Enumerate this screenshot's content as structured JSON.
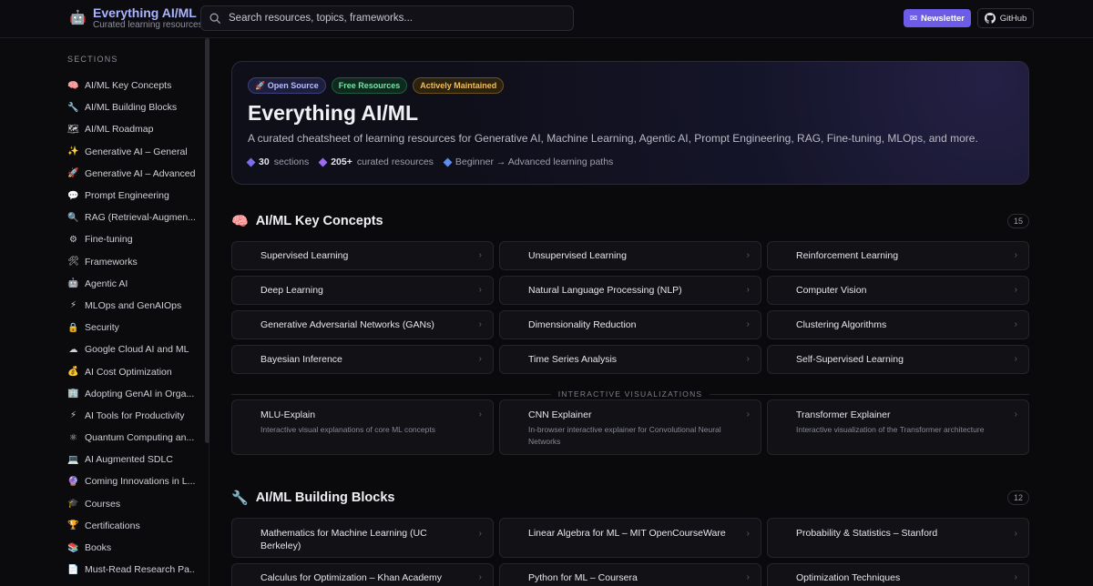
{
  "header": {
    "brand_title": "Everything AI/ML",
    "brand_subtitle": "Curated learning resources",
    "search_placeholder": "Search resources, topics, frameworks...",
    "newsletter_label": "Newsletter",
    "github_label": "GitHub"
  },
  "sidebar": {
    "title": "SECTIONS",
    "items": [
      {
        "icon": "🧠",
        "label": "AI/ML Key Concepts"
      },
      {
        "icon": "🔧",
        "label": "AI/ML Building Blocks"
      },
      {
        "icon": "🗺",
        "label": "AI/ML Roadmap"
      },
      {
        "icon": "✨",
        "label": "Generative AI – General"
      },
      {
        "icon": "🚀",
        "label": "Generative AI – Advanced"
      },
      {
        "icon": "💬",
        "label": "Prompt Engineering"
      },
      {
        "icon": "🔍",
        "label": "RAG (Retrieval-Augmen..."
      },
      {
        "icon": "⚙",
        "label": "Fine-tuning"
      },
      {
        "icon": "🛠",
        "label": "Frameworks"
      },
      {
        "icon": "🤖",
        "label": "Agentic AI"
      },
      {
        "icon": "⚡",
        "label": "MLOps and GenAIOps"
      },
      {
        "icon": "🔒",
        "label": "Security"
      },
      {
        "icon": "☁",
        "label": "Google Cloud AI and ML"
      },
      {
        "icon": "💰",
        "label": "AI Cost Optimization"
      },
      {
        "icon": "🏢",
        "label": "Adopting GenAI in Orga..."
      },
      {
        "icon": "⚡",
        "label": "AI Tools for Productivity"
      },
      {
        "icon": "⚛",
        "label": "Quantum Computing an..."
      },
      {
        "icon": "💻",
        "label": "AI Augmented SDLC"
      },
      {
        "icon": "🔮",
        "label": "Coming Innovations in L..."
      },
      {
        "icon": "🎓",
        "label": "Courses"
      },
      {
        "icon": "🏆",
        "label": "Certifications"
      },
      {
        "icon": "📚",
        "label": "Books"
      },
      {
        "icon": "📄",
        "label": "Must-Read Research Pa..."
      }
    ]
  },
  "hero": {
    "badges": [
      "🚀 Open Source",
      "Free Resources",
      "Actively Maintained"
    ],
    "title": "Everything AI/ML",
    "description": "A curated cheatsheet of learning resources for Generative AI, Machine Learning, Agentic AI, Prompt Engineering, RAG, Fine-tuning, MLOps, and more.",
    "stats": [
      {
        "value": "30",
        "label": "sections",
        "color": "#7c6cf0"
      },
      {
        "value": "205+",
        "label": "curated resources",
        "color": "#9b6cf0"
      },
      {
        "value": "",
        "label": "Beginner → Advanced learning paths",
        "color": "#5b8ef0"
      }
    ]
  },
  "sections": [
    {
      "icon": "🧠",
      "title": "AI/ML Key Concepts",
      "count": "15",
      "cards": [
        "Supervised Learning",
        "Unsupervised Learning",
        "Reinforcement Learning",
        "Deep Learning",
        "Natural Language Processing (NLP)",
        "Computer Vision",
        "Generative Adversarial Networks (GANs)",
        "Dimensionality Reduction",
        "Clustering Algorithms",
        "Bayesian Inference",
        "Time Series Analysis",
        "Self-Supervised Learning"
      ],
      "viz_label": "INTERACTIVE VISUALIZATIONS",
      "viz_cards": [
        {
          "title": "MLU-Explain",
          "sub": "Interactive visual explanations of core ML concepts"
        },
        {
          "title": "CNN Explainer",
          "sub": "In-browser interactive explainer for Convolutional Neural Networks"
        },
        {
          "title": "Transformer Explainer",
          "sub": "Interactive visualization of the Transformer architecture"
        }
      ]
    },
    {
      "icon": "🔧",
      "title": "AI/ML Building Blocks",
      "count": "12",
      "cards": [
        "Mathematics for Machine Learning (UC Berkeley)",
        "Linear Algebra for ML – MIT OpenCourseWare",
        "Probability & Statistics – Stanford",
        "Calculus for Optimization – Khan Academy",
        "Python for ML – Coursera",
        "Optimization Techniques"
      ]
    }
  ]
}
